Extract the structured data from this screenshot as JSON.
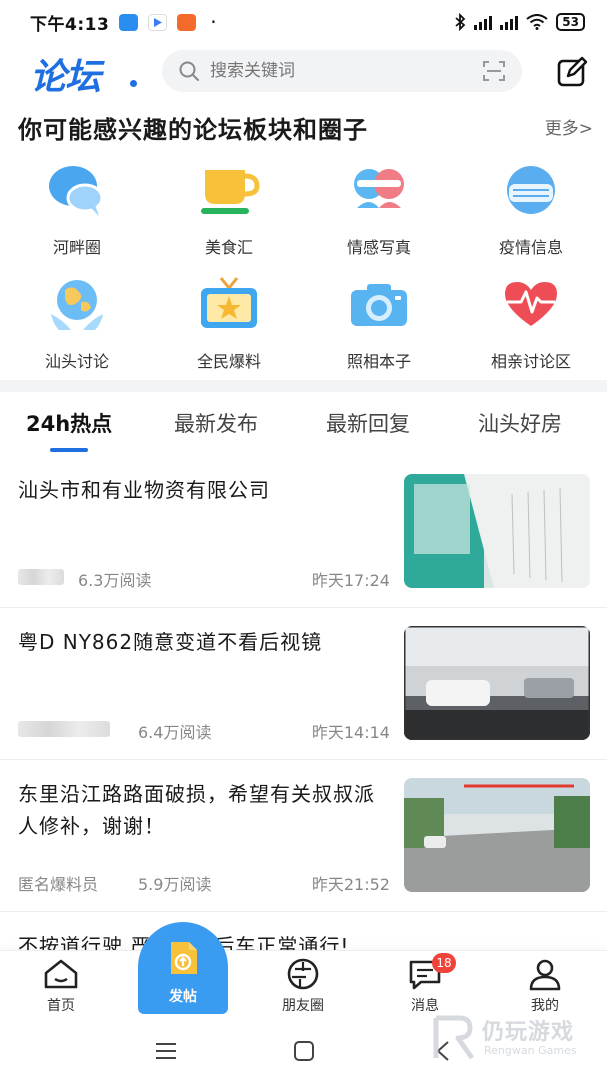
{
  "status_bar": {
    "time": "下午4:13",
    "dot": "·",
    "battery": "53"
  },
  "header": {
    "logo": "论坛",
    "search_placeholder": "搜索关键词"
  },
  "section": {
    "title": "你可能感兴趣的论坛板块和圈子",
    "more": "更多>"
  },
  "forums": [
    {
      "label": "河畔圈",
      "icon": "chat-bubbles-icon"
    },
    {
      "label": "美食汇",
      "icon": "teacup-icon"
    },
    {
      "label": "情感写真",
      "icon": "couple-icon"
    },
    {
      "label": "疫情信息",
      "icon": "mask-icon"
    },
    {
      "label": "汕头讨论",
      "icon": "globe-hands-icon"
    },
    {
      "label": "全民爆料",
      "icon": "tv-icon"
    },
    {
      "label": "照相本子",
      "icon": "camera-icon"
    },
    {
      "label": "相亲讨论区",
      "icon": "heartbeat-icon"
    }
  ],
  "tabs": [
    "24h热点",
    "最新发布",
    "最新回复",
    "汕头好房"
  ],
  "posts": [
    {
      "title": "汕头市和有业物资有限公司",
      "author": "",
      "reads": "6.3万阅读",
      "time": "昨天17:24"
    },
    {
      "title": "粤D NY862随意变道不看后视镜",
      "author": "",
      "reads": "6.4万阅读",
      "time": "昨天14:14"
    },
    {
      "title": "东里沿江路路面破损，希望有关叔叔派人修补，谢谢！",
      "author": "匿名爆料员",
      "reads": "5.9万阅读",
      "time": "昨天21:52"
    }
  ],
  "partial_post_title": "不按道行驶 严重影响后车正常通行!",
  "bottom_nav": {
    "home": "首页",
    "post": "发帖",
    "friends": "朋友圈",
    "messages": "消息",
    "messages_badge": "18",
    "mine": "我的"
  },
  "watermark": {
    "text": "仍玩游戏",
    "sub": "Rengwan Games"
  },
  "colors": {
    "accent": "#1f6fe0",
    "fab": "#3a9cf0",
    "badge": "#f0443a"
  }
}
